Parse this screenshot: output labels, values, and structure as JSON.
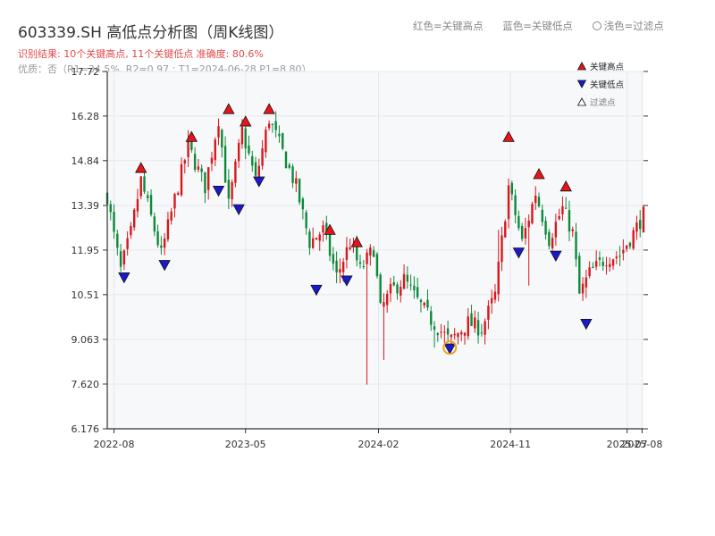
{
  "header": {
    "title": "603339.SH 高低点分析图（周K线图）",
    "subtitle": "识别结果: 10个关键高点, 11个关键低点  准确度: 80.6%",
    "quality": "优质：否（R1=34.5%, R2=0.97 ; T1=2024-06-28 P1=8.80）"
  },
  "top_legend": {
    "red": "红色=关键高点",
    "blue": "蓝色=关键低点",
    "light": "浅色=过滤点"
  },
  "legend": {
    "high": "关键高点",
    "low": "关键低点",
    "filtered": "过滤点"
  },
  "colors": {
    "up": "#d9161c",
    "down": "#0c8a3a",
    "high_marker": "#e8141a",
    "low_marker": "#1a1acc",
    "filter_marker": "#f0a020",
    "plot_bg": "#f7f8fa",
    "grid": "#e4e7ec"
  },
  "chart_data": {
    "type": "candlestick",
    "yticks": [
      "6.176",
      "7.620",
      "9.063",
      "10.51",
      "11.95",
      "13.39",
      "14.84",
      "16.28",
      "17.72"
    ],
    "ylim": [
      6.176,
      17.72
    ],
    "xticks": [
      {
        "label": "2022-08",
        "date": "2022-08-01"
      },
      {
        "label": "2023-05",
        "date": "2023-05-01"
      },
      {
        "label": "2024-02",
        "date": "2024-02-01"
      },
      {
        "label": "2024-11",
        "date": "2024-11-01"
      },
      {
        "label": "2025-07",
        "date": "2025-07-01"
      },
      {
        "label": "2025-08",
        "date": "2025-08-01"
      }
    ],
    "xlim": [
      "2022-07-18",
      "2025-08-04"
    ],
    "close_path": [
      [
        "2022-07-18",
        13.7
      ],
      [
        "2022-08-01",
        12.4
      ],
      [
        "2022-08-15",
        11.3
      ],
      [
        "2022-09-05",
        12.5
      ],
      [
        "2022-09-26",
        14.2
      ],
      [
        "2022-10-17",
        13.0
      ],
      [
        "2022-11-07",
        11.8
      ],
      [
        "2022-12-05",
        13.6
      ],
      [
        "2023-01-02",
        15.3
      ],
      [
        "2023-02-06",
        14.0
      ],
      [
        "2023-03-06",
        16.2
      ],
      [
        "2023-03-27",
        13.4
      ],
      [
        "2023-04-24",
        15.8
      ],
      [
        "2023-05-22",
        14.2
      ],
      [
        "2023-06-19",
        16.2
      ],
      [
        "2023-08-14",
        14.0
      ],
      [
        "2023-09-11",
        12.2
      ],
      [
        "2023-10-09",
        12.6
      ],
      [
        "2023-11-06",
        11.1
      ],
      [
        "2023-12-04",
        12.2
      ],
      [
        "2023-12-25",
        11.3
      ],
      [
        "2024-01-22",
        12.0
      ],
      [
        "2024-02-05",
        10.0
      ],
      [
        "2024-02-26",
        10.6
      ],
      [
        "2024-03-25",
        11.0
      ],
      [
        "2024-04-22",
        10.3
      ],
      [
        "2024-05-20",
        9.7
      ],
      [
        "2024-06-28",
        9.0
      ],
      [
        "2024-08-05",
        9.6
      ],
      [
        "2024-09-02",
        9.4
      ],
      [
        "2024-09-30",
        10.5
      ],
      [
        "2024-10-28",
        14.0
      ],
      [
        "2024-11-25",
        12.2
      ],
      [
        "2024-12-23",
        13.8
      ],
      [
        "2025-01-20",
        12.3
      ],
      [
        "2025-02-17",
        13.3
      ],
      [
        "2025-03-10",
        12.5
      ],
      [
        "2025-03-24",
        10.5
      ],
      [
        "2025-04-14",
        11.2
      ],
      [
        "2025-05-19",
        11.7
      ],
      [
        "2025-06-16",
        11.8
      ],
      [
        "2025-07-14",
        12.5
      ],
      [
        "2025-08-04",
        13.1
      ]
    ],
    "spikes": [
      [
        "2024-01-08",
        7.6
      ],
      [
        "2024-05-27",
        8.8
      ],
      [
        "2024-10-07",
        12.6
      ],
      [
        "2024-12-09",
        10.8
      ],
      [
        "2024-07-15",
        8.9
      ],
      [
        "2024-02-12",
        8.4
      ]
    ],
    "key_highs": [
      {
        "date": "2022-09-26",
        "price": 14.4
      },
      {
        "date": "2023-01-09",
        "price": 15.4
      },
      {
        "date": "2023-03-27",
        "price": 16.3
      },
      {
        "date": "2023-05-01",
        "price": 15.9
      },
      {
        "date": "2023-06-19",
        "price": 16.3
      },
      {
        "date": "2023-10-23",
        "price": 12.4
      },
      {
        "date": "2023-12-18",
        "price": 12.0
      },
      {
        "date": "2024-10-28",
        "price": 15.4
      },
      {
        "date": "2024-12-30",
        "price": 14.2
      },
      {
        "date": "2025-02-24",
        "price": 13.8
      }
    ],
    "key_lows": [
      {
        "date": "2022-08-22",
        "price": 11.1
      },
      {
        "date": "2022-11-14",
        "price": 11.5
      },
      {
        "date": "2023-03-06",
        "price": 13.9
      },
      {
        "date": "2023-04-17",
        "price": 13.3
      },
      {
        "date": "2023-05-29",
        "price": 14.2
      },
      {
        "date": "2023-09-25",
        "price": 10.7
      },
      {
        "date": "2023-11-27",
        "price": 11.0
      },
      {
        "date": "2024-06-28",
        "price": 8.8
      },
      {
        "date": "2024-11-18",
        "price": 11.9
      },
      {
        "date": "2025-02-03",
        "price": 11.8
      },
      {
        "date": "2025-04-07",
        "price": 9.6
      }
    ],
    "filtered_points": [
      {
        "date": "2024-06-28",
        "price": 8.8
      }
    ]
  }
}
